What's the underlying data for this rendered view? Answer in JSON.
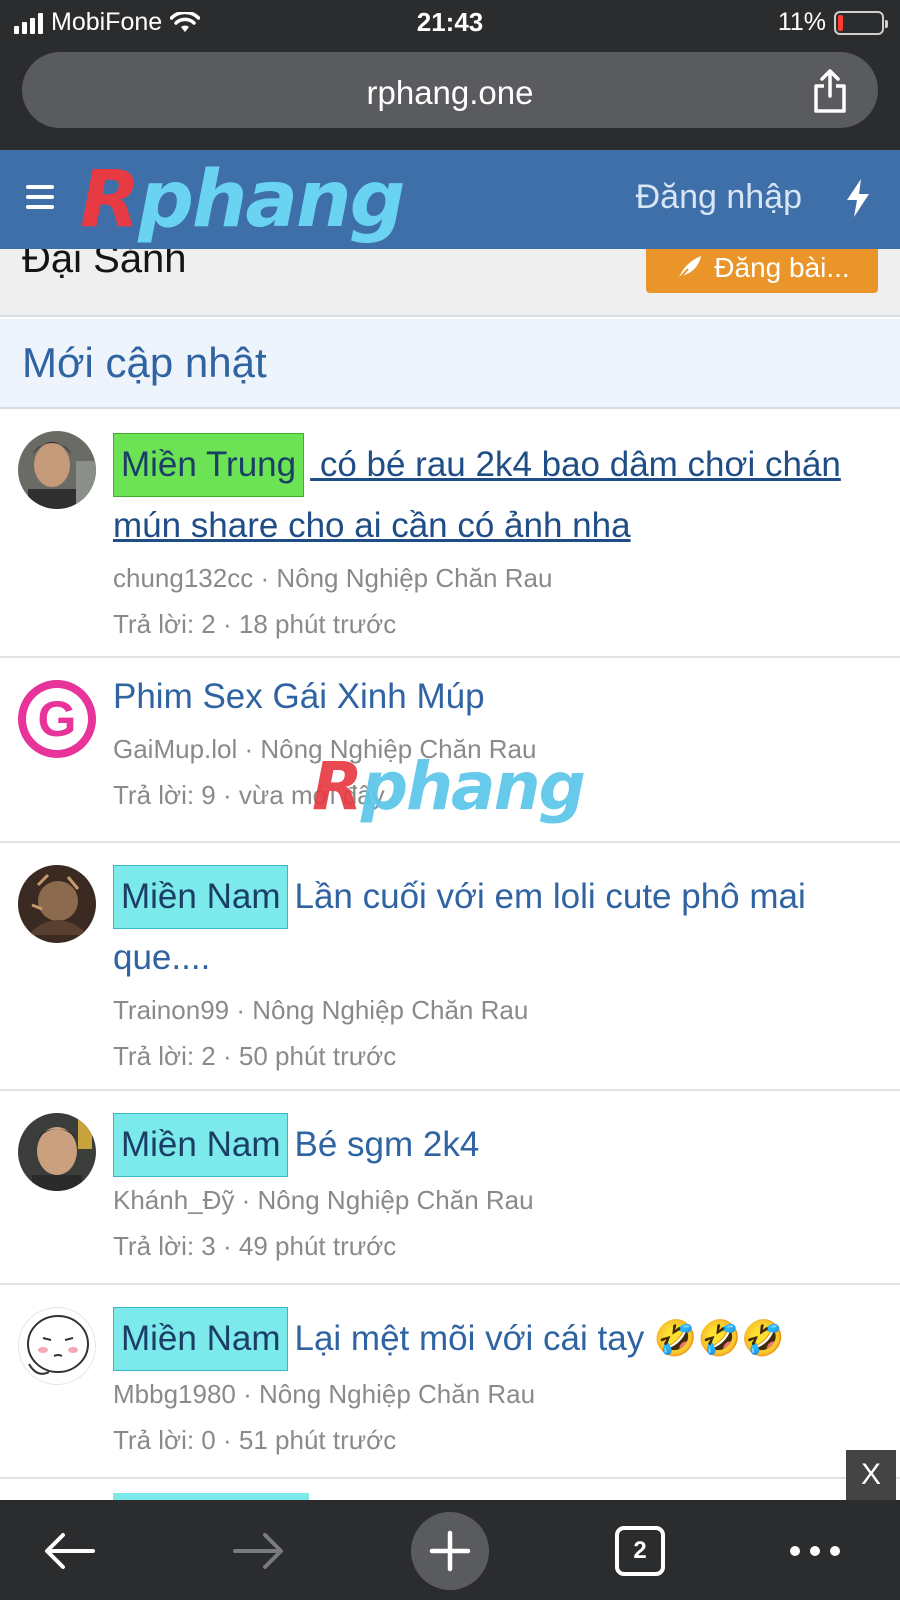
{
  "status_bar": {
    "carrier": "MobiFone",
    "time": "21:43",
    "battery_percent": "11%",
    "battery_level": 0.11,
    "signal_icon": "signal-bars-icon",
    "wifi_icon": "wifi-icon"
  },
  "browser": {
    "url": "rphang.one",
    "share_icon": "share-icon",
    "tab_count": "2",
    "toolbar_icons": [
      "back-arrow-icon",
      "forward-arrow-icon",
      "new-tab-plus-icon",
      "tabs-icon",
      "more-dots-icon"
    ]
  },
  "header": {
    "logo_part1": "R",
    "logo_part2": "phang",
    "login": "Đăng nhập",
    "menu_icon": "hamburger-icon",
    "bolt_icon": "bolt-icon",
    "brand_colors": {
      "header_bg": "#3f6fa8",
      "logo_red": "#e83a43",
      "logo_cyan": "#6ad3f2"
    }
  },
  "page": {
    "title": "Đại Sảnh",
    "post_button": "Đăng bài...",
    "post_icon": "feather-icon",
    "post_button_color": "#e9952a"
  },
  "section": {
    "title": "Mới cập nhật"
  },
  "threads": [
    {
      "prefix": "Miền Trung",
      "prefix_color": "#6be354",
      "title": " có bé rau 2k4 bao dâm chơi chán mún share cho ai cần có ảnh nha",
      "author": "chung132cc",
      "forum": "Nông Nghiệp Chăn Rau",
      "replies": "Trả lời: 2",
      "time": "18 phút trước"
    },
    {
      "prefix": "",
      "title": "Phim Sex Gái Xinh Múp",
      "author": "GaiMup.lol",
      "forum": "Nông Nghiệp Chăn Rau",
      "replies": "Trả lời: 9",
      "time": "vừa mới đây",
      "avatar_letter": "G"
    },
    {
      "prefix": "Miền Nam",
      "prefix_color": "#7ce9ea",
      "title": "Lần cuối với em loli cute phô mai que....",
      "author": "Trainon99",
      "forum": "Nông Nghiệp Chăn Rau",
      "replies": "Trả lời: 2",
      "time": "50 phút trước"
    },
    {
      "prefix": "Miền Nam",
      "prefix_color": "#7ce9ea",
      "title": "Bé sgm 2k4",
      "author": "Khánh_Đỹ",
      "forum": "Nông Nghiệp Chăn Rau",
      "replies": "Trả lời: 3",
      "time": "49 phút trước"
    },
    {
      "prefix": "Miền Nam",
      "prefix_color": "#7ce9ea",
      "title": "Lại mệt mõi với cái tay 🤣🤣🤣",
      "author": "Mbbg1980",
      "forum": "Nông Nghiệp Chăn Rau",
      "replies": "Trả lời: 0",
      "time": "51 phút trước"
    }
  ],
  "meta_separator": " · ",
  "watermark": {
    "part1": "R",
    "part2": "phang"
  },
  "close_ad": "X"
}
